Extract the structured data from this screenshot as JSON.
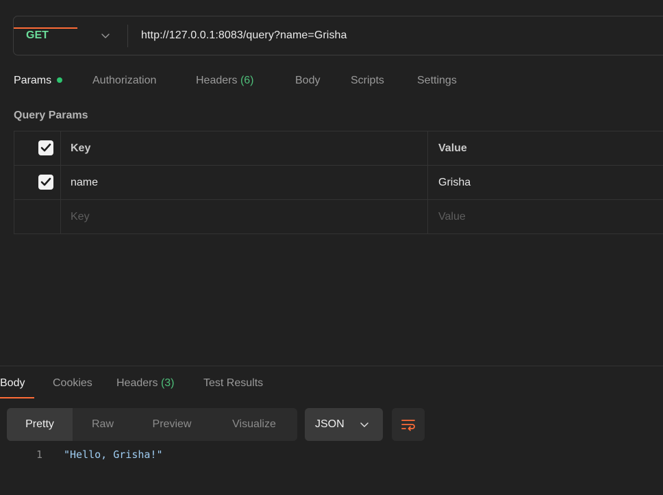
{
  "request": {
    "method": "GET",
    "url": "http://127.0.0.1:8083/query?name=Grisha"
  },
  "request_tabs": [
    {
      "label": "Params",
      "count": "",
      "active": true,
      "indicator": true
    },
    {
      "label": "Authorization",
      "count": "",
      "active": false
    },
    {
      "label": "Headers",
      "count": "(6)",
      "active": false
    },
    {
      "label": "Body",
      "count": "",
      "active": false
    },
    {
      "label": "Scripts",
      "count": "",
      "active": false
    },
    {
      "label": "Settings",
      "count": "",
      "active": false
    }
  ],
  "query_params": {
    "title": "Query Params",
    "columns": {
      "key": "Key",
      "value": "Value"
    },
    "rows": [
      {
        "checked": true,
        "key": "name",
        "value": "Grisha"
      }
    ],
    "placeholder": {
      "key": "Key",
      "value": "Value"
    }
  },
  "response_tabs": [
    {
      "label": "Body",
      "count": "",
      "active": true
    },
    {
      "label": "Cookies",
      "count": "",
      "active": false
    },
    {
      "label": "Headers",
      "count": "(3)",
      "active": false
    },
    {
      "label": "Test Results",
      "count": "",
      "active": false
    }
  ],
  "response_view": {
    "modes": [
      "Pretty",
      "Raw",
      "Preview",
      "Visualize"
    ],
    "active_mode": "Pretty",
    "format": "JSON"
  },
  "response_body": [
    {
      "line": "1",
      "text": "\"Hello, Grisha!\""
    }
  ],
  "colors": {
    "background": "#212121",
    "method_get": "#6bdd9a",
    "accent": "#ff6c37",
    "count": "#4fbf7a",
    "string": "#9fcdf2"
  },
  "icons": [
    "chevron-down-icon",
    "checkmark-icon",
    "wrap-lines-icon"
  ]
}
